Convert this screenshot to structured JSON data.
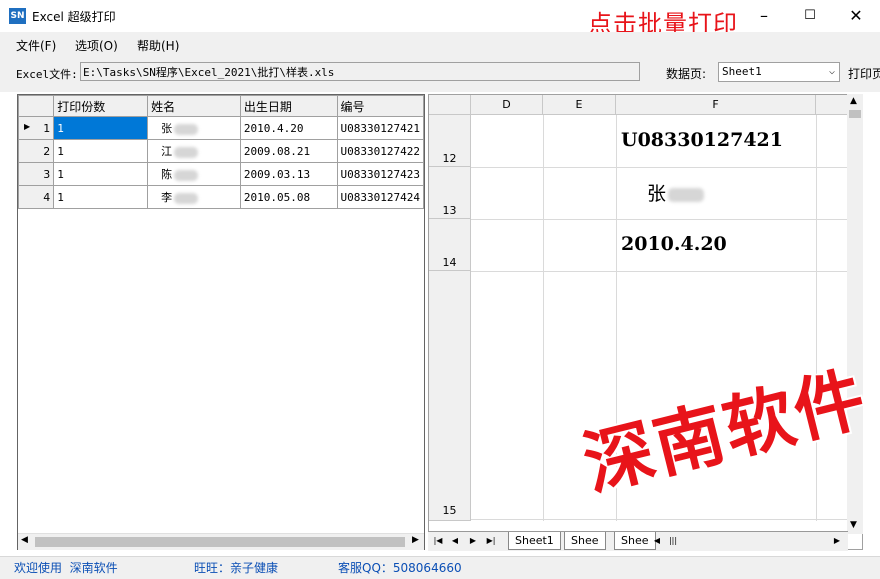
{
  "window": {
    "icon_text": "SN",
    "title": "Excel 超级打印",
    "overlay_hint": "点击批量打印",
    "minimize": "–",
    "maximize": "☐",
    "close": "✕"
  },
  "menu": [
    "文件(F)",
    "选项(O)",
    "帮助(H)"
  ],
  "file_row": {
    "file_label": "Excel文件:",
    "file_value": "E:\\Tasks\\SN程序\\Excel_2021\\批打\\样表.xls",
    "sheet_label": "数据页:",
    "sheet_value": "Sheet1",
    "print_label": "打印页"
  },
  "grid": {
    "columns": [
      "打印份数",
      "姓名",
      "出生日期",
      "编号"
    ],
    "rows": [
      {
        "num": "1",
        "copies": "1",
        "name": "张",
        "birth": "2010.4.20",
        "code": "U08330127421"
      },
      {
        "num": "2",
        "copies": "1",
        "name": "江",
        "birth": "2009.08.21",
        "code": "U08330127422"
      },
      {
        "num": "3",
        "copies": "1",
        "name": "陈",
        "birth": "2009.03.13",
        "code": "U08330127423"
      },
      {
        "num": "4",
        "copies": "1",
        "name": "李",
        "birth": "2010.05.08",
        "code": "U08330127424"
      }
    ]
  },
  "preview": {
    "columns": [
      "D",
      "E",
      "F"
    ],
    "row_numbers": [
      "12",
      "13",
      "14",
      "15"
    ],
    "cell_code": "U08330127421",
    "cell_name": "张",
    "cell_date": "2010.4.20",
    "tabs": [
      "Sheet1",
      "Shee",
      "Shee"
    ]
  },
  "watermark": "深南软件",
  "status": {
    "welcome": "欢迎使用  深南软件",
    "wangwang": "旺旺：亲子健康",
    "qq": "客服QQ：508064660"
  },
  "colors": {
    "accent_red": "#e8141a",
    "selection_blue": "#0078d7",
    "status_blue": "#0b4fb5"
  }
}
